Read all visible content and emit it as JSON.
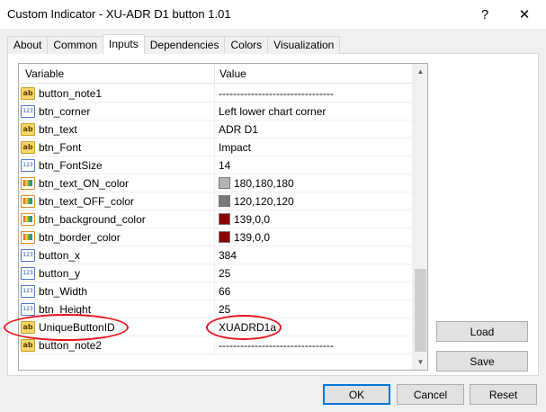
{
  "window": {
    "title": "Custom Indicator - XU-ADR D1 button 1.01",
    "help_label": "?",
    "close_label": "✕"
  },
  "tabs": [
    {
      "label": "About",
      "active": false
    },
    {
      "label": "Common",
      "active": false
    },
    {
      "label": "Inputs",
      "active": true
    },
    {
      "label": "Dependencies",
      "active": false
    },
    {
      "label": "Colors",
      "active": false
    },
    {
      "label": "Visualization",
      "active": false
    }
  ],
  "grid": {
    "header_variable": "Variable",
    "header_value": "Value",
    "rows": [
      {
        "icon": "ab",
        "variable": "button_note1",
        "value": "--------------------------------",
        "swatch": ""
      },
      {
        "icon": "num",
        "variable": "btn_corner",
        "value": "Left lower chart corner",
        "swatch": ""
      },
      {
        "icon": "ab",
        "variable": "btn_text",
        "value": "ADR D1",
        "swatch": ""
      },
      {
        "icon": "ab",
        "variable": "btn_Font",
        "value": "Impact",
        "swatch": ""
      },
      {
        "icon": "num",
        "variable": "btn_FontSize",
        "value": "14",
        "swatch": ""
      },
      {
        "icon": "col",
        "variable": "btn_text_ON_color",
        "value": "180,180,180",
        "swatch": "#b4b4b4"
      },
      {
        "icon": "col",
        "variable": "btn_text_OFF_color",
        "value": "120,120,120",
        "swatch": "#787878"
      },
      {
        "icon": "col",
        "variable": "btn_background_color",
        "value": "139,0,0",
        "swatch": "#8b0000"
      },
      {
        "icon": "col",
        "variable": "btn_border_color",
        "value": "139,0,0",
        "swatch": "#8b0000"
      },
      {
        "icon": "num",
        "variable": "button_x",
        "value": "384",
        "swatch": ""
      },
      {
        "icon": "num",
        "variable": "button_y",
        "value": "25",
        "swatch": ""
      },
      {
        "icon": "num",
        "variable": "btn_Width",
        "value": "66",
        "swatch": ""
      },
      {
        "icon": "num",
        "variable": "btn_Height",
        "value": "25",
        "swatch": ""
      },
      {
        "icon": "ab",
        "variable": "UniqueButtonID",
        "value": "XUADRD1a",
        "swatch": ""
      },
      {
        "icon": "ab",
        "variable": "button_note2",
        "value": "--------------------------------",
        "swatch": ""
      }
    ]
  },
  "icon_glyphs": {
    "ab": "ab",
    "num": "123",
    "col": ""
  },
  "side_buttons": {
    "load_label": "Load",
    "save_label": "Save"
  },
  "footer": {
    "ok_label": "OK",
    "cancel_label": "Cancel",
    "reset_label": "Reset"
  },
  "colors": {
    "annotation": "#e8141b",
    "accent": "#0078d7"
  }
}
